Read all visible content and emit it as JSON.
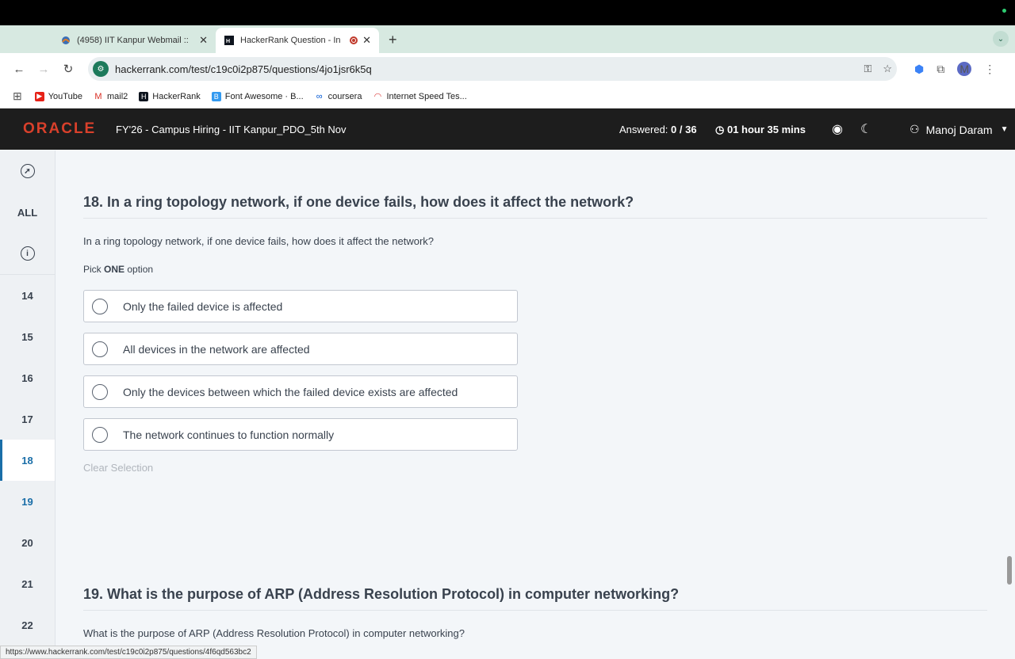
{
  "browser": {
    "tabs": [
      {
        "title": "(4958) IIT Kanpur Webmail ::",
        "active": false,
        "favicon": "webmail-icon"
      },
      {
        "title": "HackerRank Question - In",
        "active": true,
        "favicon": "hackerrank-icon"
      }
    ],
    "url": "hackerrank.com/test/c19c0i2p875/questions/4jo1jsr6k5q",
    "profile_initial": "M",
    "bookmarks": [
      {
        "label": "YouTube",
        "icon": "youtube-icon",
        "color": "#e62117"
      },
      {
        "label": "mail2",
        "icon": "gmail-icon",
        "color": "#d93025"
      },
      {
        "label": "HackerRank",
        "icon": "hackerrank-icon",
        "color": "#1ba94c"
      },
      {
        "label": "Font Awesome · B...",
        "icon": "fontawesome-icon",
        "color": "#339af0"
      },
      {
        "label": "coursera",
        "icon": "coursera-icon",
        "color": "#0056d2"
      },
      {
        "label": "Internet Speed Tes...",
        "icon": "speedtest-icon",
        "color": "#d44"
      }
    ],
    "status_url": "https://www.hackerrank.com/test/c19c0i2p875/questions/4f6qd563bc2"
  },
  "header": {
    "logo": "ORACLE",
    "test_title": "FY'26 - Campus Hiring - IIT Kanpur_PDO_5th Nov",
    "answered_label": "Answered:",
    "answered_value": "0 / 36",
    "timer": "01 hour 35 mins",
    "user_name": "Manoj Daram"
  },
  "sidebar": {
    "top": [
      "ALL"
    ],
    "numbers": [
      "14",
      "15",
      "16",
      "17",
      "18",
      "19",
      "20",
      "21",
      "22"
    ],
    "active": "18"
  },
  "question18": {
    "title": "18. In a ring topology network, if one device fails, how does it affect the network?",
    "text": "In a ring topology network, if one device fails, how does it affect the network?",
    "pick_prefix": "Pick ",
    "pick_bold": "ONE",
    "pick_suffix": " option",
    "options": [
      "Only the failed device is affected",
      "All devices in the network are affected",
      "Only the devices between which the failed device exists are affected",
      "The network continues to function normally"
    ],
    "clear": "Clear Selection"
  },
  "question19": {
    "title": "19. What is the purpose of ARP (Address Resolution Protocol) in computer networking?",
    "text": "What is the purpose of ARP (Address Resolution Protocol) in computer networking?"
  },
  "colors": {
    "accent": "#1a6ea8",
    "oracle_red": "#d9402b",
    "header_bg": "#1d1d1d"
  }
}
